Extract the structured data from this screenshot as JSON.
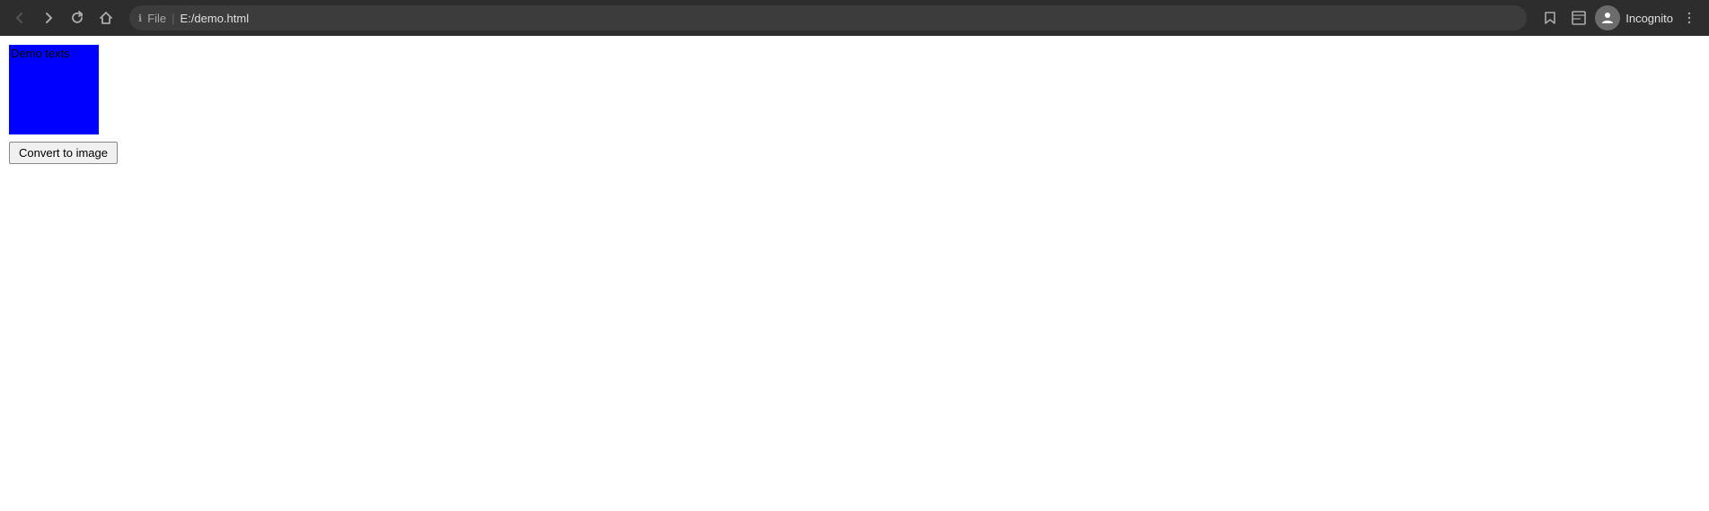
{
  "browser": {
    "back_title": "Back",
    "forward_title": "Forward",
    "reload_title": "Reload",
    "home_title": "Home",
    "file_label": "File",
    "separator": "|",
    "address": "E:/demo.html",
    "bookmark_title": "Bookmark",
    "tab_search_title": "Tab search",
    "profile_label": "Incognito",
    "menu_title": "More options"
  },
  "page": {
    "demo_text": "Demo texts",
    "box_color": "#0000ff",
    "convert_button_label": "Convert to image"
  }
}
